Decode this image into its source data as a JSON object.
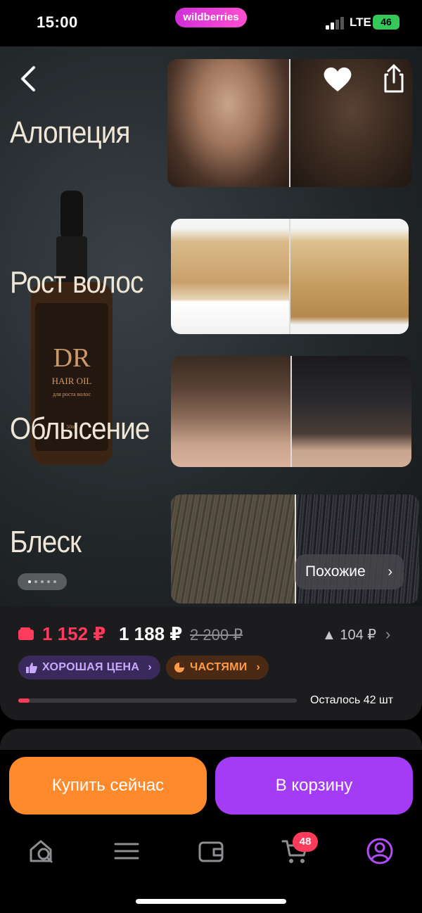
{
  "status_bar": {
    "time": "15:00",
    "brand_pill": "wildberries",
    "network": "LTE",
    "battery": "46"
  },
  "hero": {
    "labels": [
      "Алопеция",
      "Рост волос",
      "Облысение",
      "Блеск"
    ],
    "bottle_brand": "DR",
    "bottle_title": "HAIR OIL",
    "bottle_subtitle": "для роста волос",
    "bottle_volume": "50ml",
    "similar_label": "Похожие",
    "gallery": {
      "total_images": 5,
      "active_index": 1
    }
  },
  "price": {
    "wallet_price": "1 152 ₽",
    "price": "1 188 ₽",
    "old_price": "2 200 ₽",
    "delta": "104 ₽",
    "badge_good": "ХОРОШАЯ ЦЕНА",
    "badge_parts": "ЧАСТЯМИ",
    "stock_text": "Осталось 42 шт",
    "stock_progress": 0.04
  },
  "actions": {
    "buy_now": "Купить сейчас",
    "add_to_cart": "В корзину"
  },
  "tabbar": {
    "items": [
      "home-search-icon",
      "catalog-icon",
      "wallet-icon",
      "cart-icon",
      "profile-icon"
    ],
    "cart_count": "48",
    "active": "profile-icon"
  },
  "colors": {
    "accent_purple": "#a43cf5",
    "accent_orange": "#ff8a2b",
    "price_red": "#ff3b5c",
    "brand_pink": "#d02fd8"
  }
}
